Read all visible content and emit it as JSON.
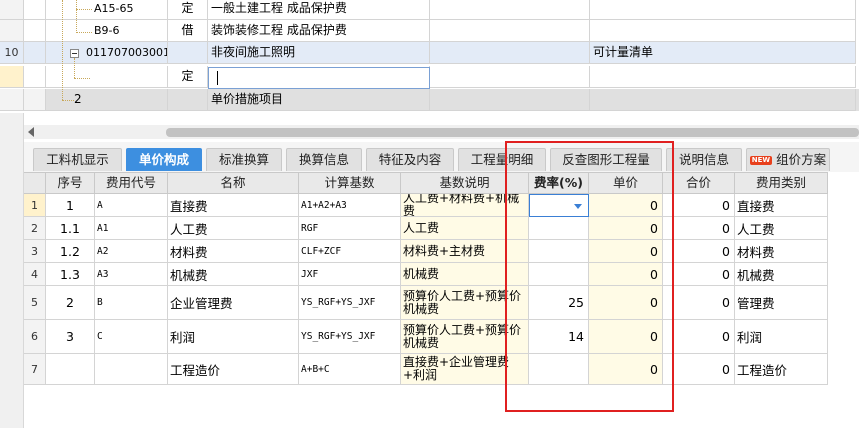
{
  "tree_rows": [
    {
      "rownum": "",
      "code": "A15-65",
      "type": "定",
      "name": "一般土建工程 成品保护费",
      "extra": ""
    },
    {
      "rownum": "",
      "code": "B9-6",
      "type": "借",
      "name": "装饰装修工程 成品保护费",
      "extra": ""
    },
    {
      "rownum": "10",
      "code": "011707003001",
      "type": "",
      "name": "非夜间施工照明",
      "extra": "可计量清单"
    },
    {
      "rownum": "",
      "code": "",
      "type": "定",
      "name": "",
      "extra": ""
    },
    {
      "rownum": "",
      "code": "2",
      "type": "",
      "name": "单价措施项目",
      "extra": ""
    }
  ],
  "tabs": [
    "工料机显示",
    "单价构成",
    "标准换算",
    "换算信息",
    "特征及内容",
    "工程量明细",
    "反查图形工程量",
    "说明信息",
    "组价方案"
  ],
  "new_badge": "NEW",
  "table": {
    "headers": [
      "序号",
      "费用代号",
      "名称",
      "计算基数",
      "基数说明",
      "费率(%)",
      "单价",
      "合价",
      "费用类别"
    ],
    "rows": [
      {
        "rn": "1",
        "seq": "1",
        "code": "A",
        "name": "直接费",
        "base": "A1+A2+A3",
        "desc": "人工费+材料费+机械费",
        "rate": "",
        "price": "0",
        "total": "0",
        "cat": "直接费"
      },
      {
        "rn": "2",
        "seq": "1.1",
        "code": "A1",
        "name": "人工费",
        "base": "RGF",
        "desc": "人工费",
        "rate": "",
        "price": "0",
        "total": "0",
        "cat": "人工费"
      },
      {
        "rn": "3",
        "seq": "1.2",
        "code": "A2",
        "name": "材料费",
        "base": "CLF+ZCF",
        "desc": "材料费+主材费",
        "rate": "",
        "price": "0",
        "total": "0",
        "cat": "材料费"
      },
      {
        "rn": "4",
        "seq": "1.3",
        "code": "A3",
        "name": "机械费",
        "base": "JXF",
        "desc": "机械费",
        "rate": "",
        "price": "0",
        "total": "0",
        "cat": "机械费"
      },
      {
        "rn": "5",
        "seq": "2",
        "code": "B",
        "name": "企业管理费",
        "base": "YS_RGF+YS_JXF",
        "desc": "预算价人工费+预算价机械费",
        "rate": "25",
        "price": "0",
        "total": "0",
        "cat": "管理费"
      },
      {
        "rn": "6",
        "seq": "3",
        "code": "C",
        "name": "利润",
        "base": "YS_RGF+YS_JXF",
        "desc": "预算价人工费+预算价机械费",
        "rate": "14",
        "price": "0",
        "total": "0",
        "cat": "利润"
      },
      {
        "rn": "7",
        "seq": "",
        "code": "",
        "name": "工程造价",
        "base": "A+B+C",
        "desc": "直接费+企业管理费+利润",
        "rate": "",
        "price": "0",
        "total": "0",
        "cat": "工程造价"
      }
    ]
  },
  "colors": {
    "accent": "#3d8fe0",
    "highlight": "#e02020",
    "new_badge": "#e8401c"
  },
  "icons": {
    "collapse": "minus-box-icon",
    "dropdown": "chevron-down-icon",
    "scroll_left": "arrow-left-icon"
  }
}
